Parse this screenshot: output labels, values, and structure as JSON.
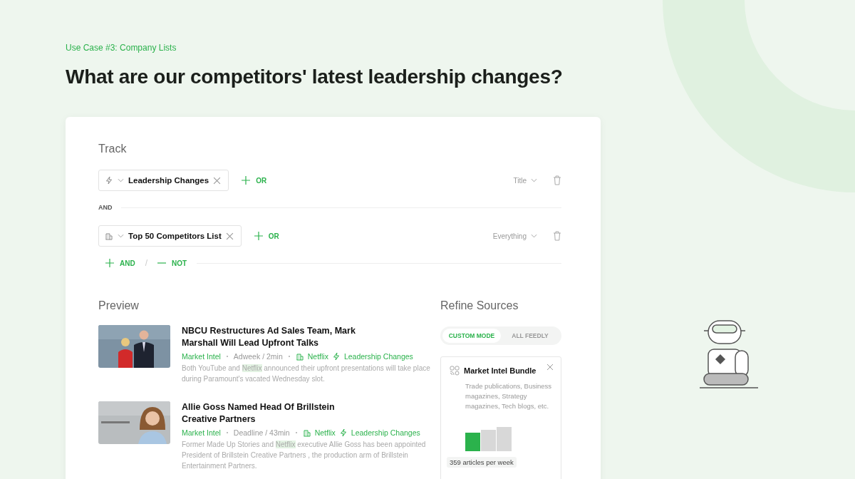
{
  "eyebrow": "Use Case #3: Company Lists",
  "headline": "What are our competitors' latest leadership changes?",
  "track": {
    "title": "Track",
    "rules": [
      {
        "kind": "topic",
        "chip": "Leadership Changes",
        "or": "OR",
        "scope": "Title"
      },
      {
        "kind": "company_list",
        "chip": "Top 50 Competitors List",
        "or": "OR",
        "scope": "Everything"
      }
    ],
    "joiner": "AND",
    "add_and": "AND",
    "separator": "/",
    "add_not": "NOT"
  },
  "preview": {
    "title": "Preview",
    "articles": [
      {
        "kind": "picture",
        "title": "NBCU Restructures Ad Sales Team, Mark Marshall Will Lead Upfront Talks",
        "feed": "Market Intel",
        "source": "Adweek / 2min",
        "company": "Netflix",
        "topic": "Leadership Changes",
        "summary": [
          {
            "text": "Both YouTube and ",
            "highlight": false
          },
          {
            "text": "Netflix",
            "highlight": true
          },
          {
            "text": " announced their upfront presentations will take place during Paramount's vacated Wednesday slot.",
            "highlight": false
          }
        ]
      },
      {
        "kind": "picture",
        "title": "Allie Goss Named Head Of Brillstein Creative Partners",
        "feed": "Market Intel",
        "source": "Deadline / 43min",
        "company": "Netflix",
        "topic": "Leadership Changes",
        "summary": [
          {
            "text": "Former Made Up Stories and ",
            "highlight": false
          },
          {
            "text": "Netflix",
            "highlight": true
          },
          {
            "text": " executive Allie Goss has been appointed President of Brillstein Creative Partners , the production arm of Brillstein Entertainment Partners.",
            "highlight": false
          }
        ]
      }
    ]
  },
  "refine": {
    "title": "Refine Sources",
    "modes": [
      {
        "label": "CUSTOM MODE",
        "selected": true
      },
      {
        "label": "ALL FEEDLY",
        "selected": false
      }
    ],
    "bundle": {
      "name": "Market Intel Bundle",
      "description": "Trade publications, Business magazines, Strategy magazines, Tech blogs, etc.",
      "volume_bars": [
        {
          "selected": true
        },
        {
          "selected": false
        },
        {
          "selected": false
        }
      ],
      "volume": "359 articles per week"
    }
  }
}
